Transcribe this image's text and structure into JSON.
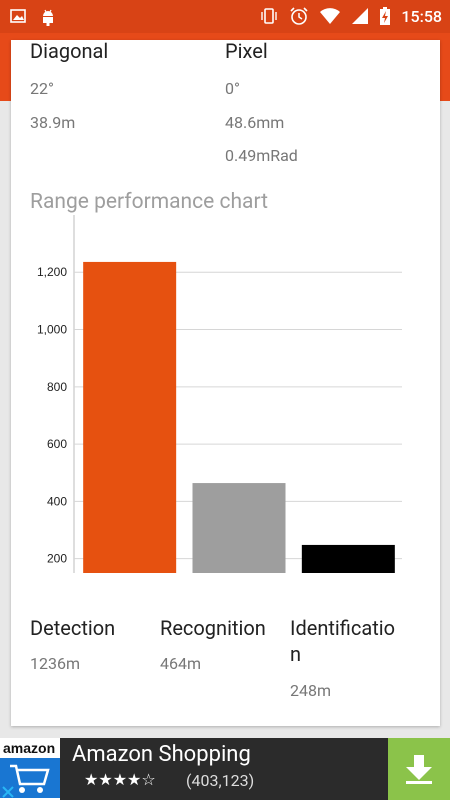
{
  "status_bar": {
    "time": "15:58"
  },
  "specs": {
    "diagonal": {
      "title": "Diagonal",
      "values": [
        "22°",
        "38.9m"
      ]
    },
    "pixel": {
      "title": "Pixel",
      "values": [
        "0°",
        "48.6mm",
        "0.49mRad"
      ]
    }
  },
  "range_chart": {
    "title": "Range performance chart"
  },
  "chart_data": {
    "type": "bar",
    "categories": [
      "Detection",
      "Recognition",
      "Identification"
    ],
    "values": [
      1236,
      464,
      248
    ],
    "colors": [
      "#e65110",
      "#9e9e9e",
      "#000000"
    ],
    "yticks": [
      200,
      400,
      600,
      800,
      1000,
      1200
    ],
    "ytick_labels": [
      "200",
      "400",
      "600",
      "800",
      "1,000",
      "1,200"
    ],
    "ylim": [
      150,
      1330
    ],
    "grid": true
  },
  "ranges": [
    {
      "label": "Detection",
      "value": "1236m"
    },
    {
      "label": "Recognition",
      "value": "464m"
    },
    {
      "label": "Identificatio\nn",
      "value": "248m"
    }
  ],
  "ad": {
    "logo_text": "amazon",
    "title": "Amazon Shopping",
    "stars": "★★★★☆",
    "rating_count": "(403,123)",
    "accent": "#8bc34a"
  }
}
